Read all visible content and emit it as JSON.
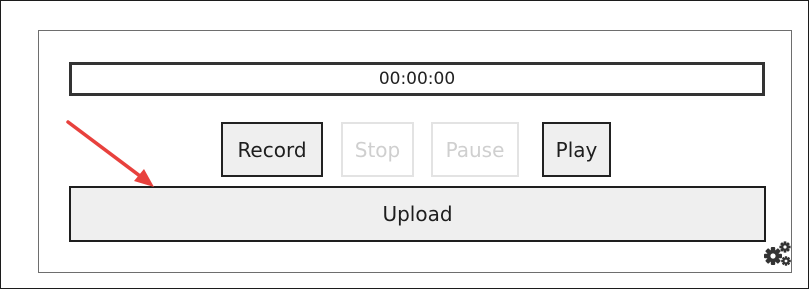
{
  "recorder": {
    "timer": "00:00:00",
    "buttons": {
      "record": "Record",
      "stop": "Stop",
      "pause": "Pause",
      "play": "Play"
    },
    "upload": "Upload"
  },
  "icons": {
    "settings": "gears-icon",
    "annotation": "arrow-icon"
  },
  "colors": {
    "annotation_arrow": "#e8413d",
    "button_fill": "#efefef",
    "disabled_text": "#cfcfcf"
  }
}
